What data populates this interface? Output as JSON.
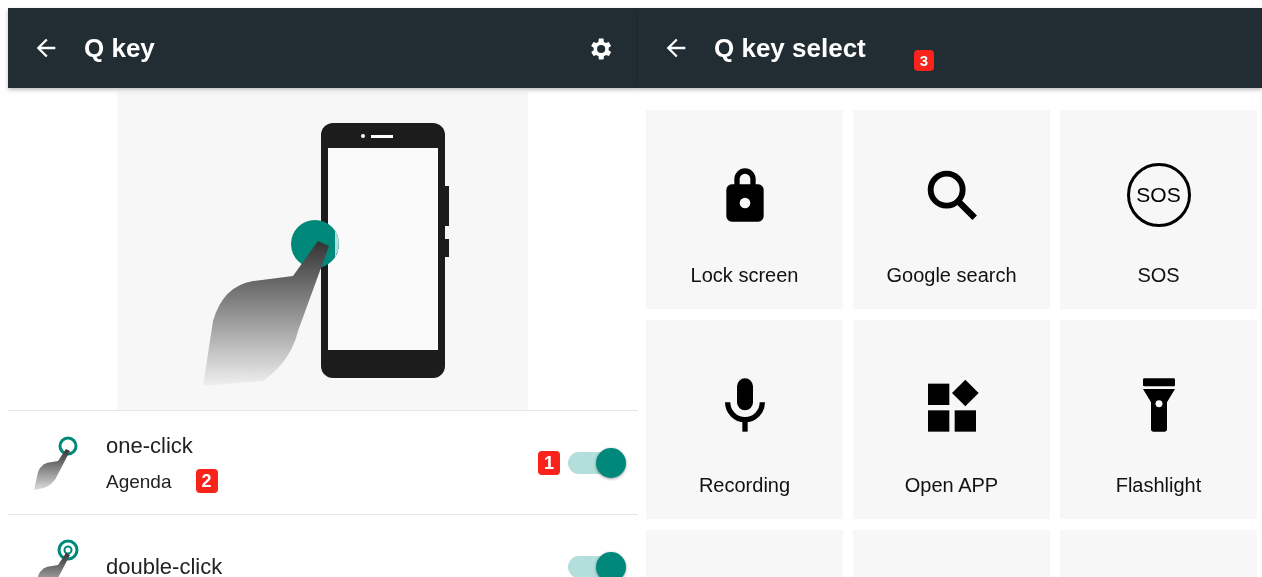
{
  "left_screen": {
    "app_bar": {
      "title": "Q key"
    },
    "modes": [
      {
        "kind": "single",
        "title": "one-click",
        "subtitle": "Agenda",
        "on": true,
        "toggle_annotation": "1",
        "subtitle_annotation": "2"
      },
      {
        "kind": "double",
        "title": "double-click",
        "on": true
      }
    ]
  },
  "right_screen": {
    "app_bar": {
      "title": "Q key select",
      "annotation": "3"
    },
    "actions": [
      {
        "kind": "lock",
        "label": "Lock screen"
      },
      {
        "kind": "search",
        "label": "Google search"
      },
      {
        "kind": "sos",
        "label": "SOS",
        "icon_text": "SOS"
      },
      {
        "kind": "mic",
        "label": "Recording"
      },
      {
        "kind": "apps",
        "label": "Open APP"
      },
      {
        "kind": "flashlight",
        "label": "Flashlight"
      },
      {
        "kind": "blank"
      },
      {
        "kind": "blank"
      },
      {
        "kind": "blank"
      }
    ]
  }
}
